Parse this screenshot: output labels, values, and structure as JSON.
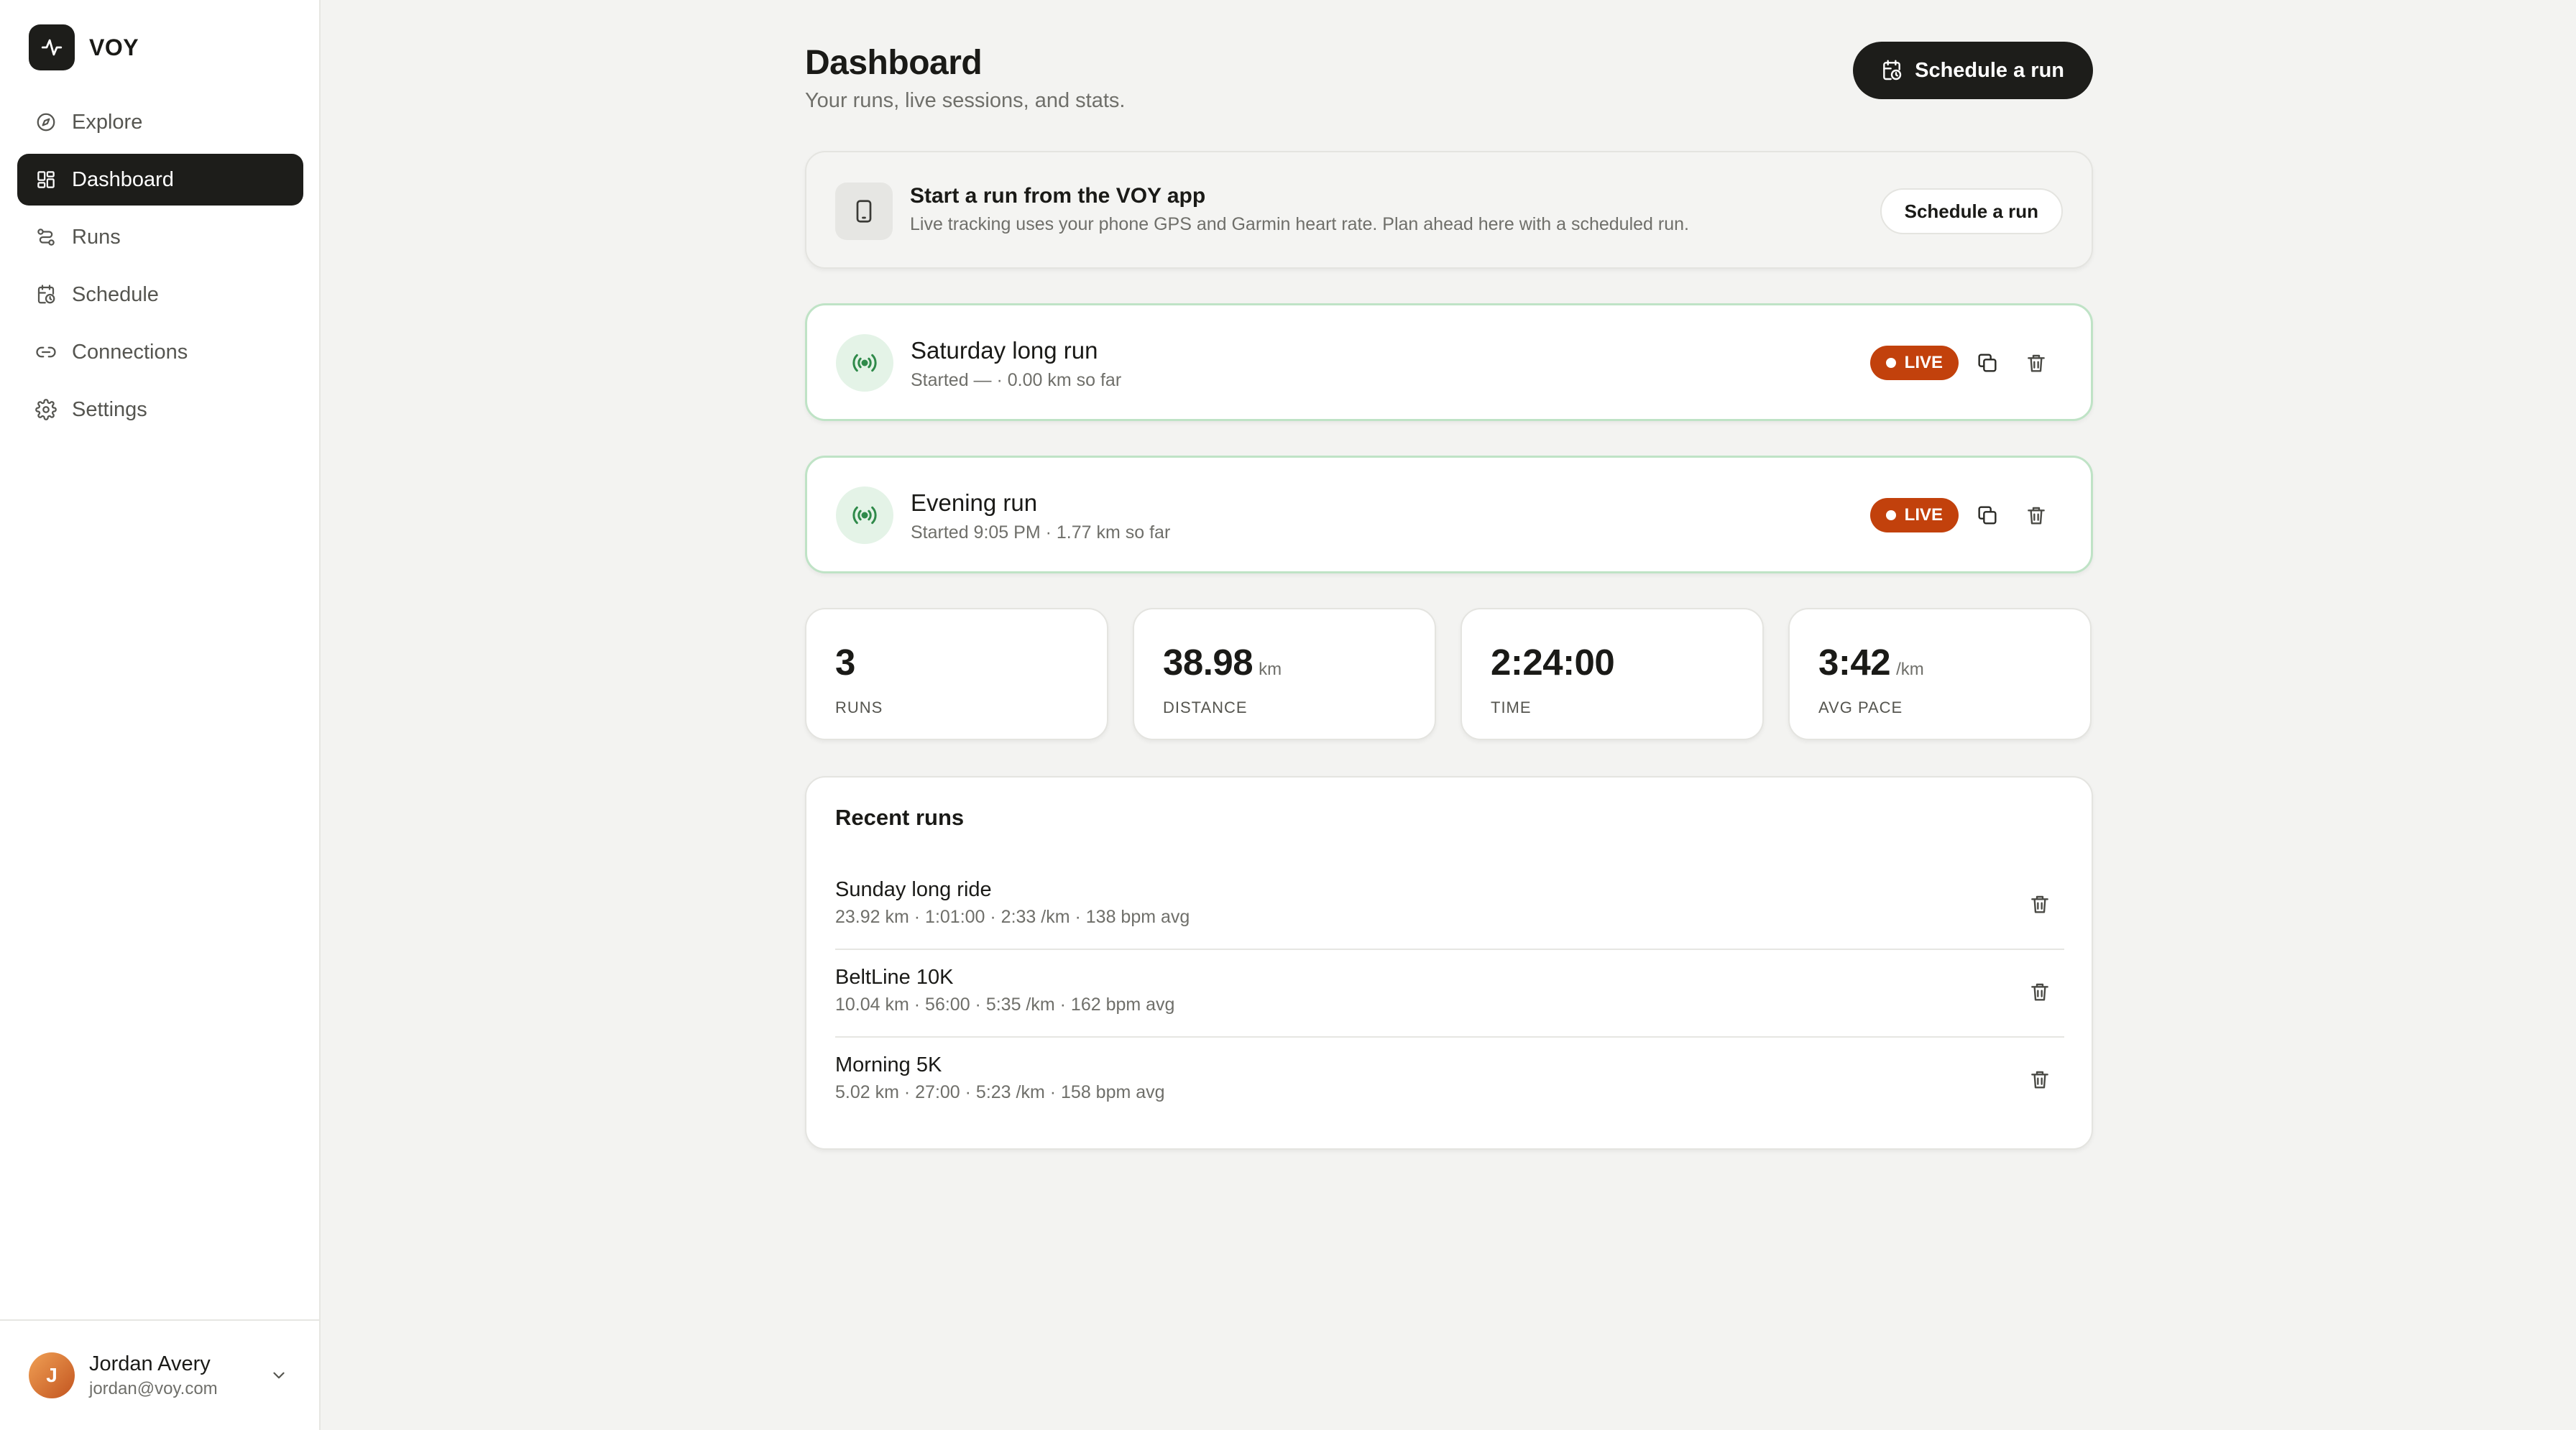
{
  "app": {
    "name": "VOY",
    "logo_icon": "activity-pulse-icon"
  },
  "sidebar": {
    "items": [
      {
        "label": "Explore",
        "icon": "compass-icon",
        "active": false
      },
      {
        "label": "Dashboard",
        "icon": "grid-icon",
        "active": true
      },
      {
        "label": "Runs",
        "icon": "route-icon",
        "active": false
      },
      {
        "label": "Schedule",
        "icon": "calendar-clock-icon",
        "active": false
      },
      {
        "label": "Connections",
        "icon": "link-icon",
        "active": false
      },
      {
        "label": "Settings",
        "icon": "gear-icon",
        "active": false
      }
    ]
  },
  "user": {
    "initial": "J",
    "name": "Jordan Avery",
    "email": "jordan@voy.com"
  },
  "header": {
    "title": "Dashboard",
    "subtitle": "Your runs, live sessions, and stats.",
    "schedule_label": "Schedule a run"
  },
  "app_banner": {
    "title": "Start a run from the VOY app",
    "description": "Live tracking uses your phone GPS and Garmin heart rate. Plan ahead here with a scheduled run.",
    "button_label": "Schedule a run"
  },
  "live_sessions": [
    {
      "title": "Saturday long run",
      "meta": "Started — · 0.00 km so far",
      "badge": "LIVE"
    },
    {
      "title": "Evening run",
      "meta": "Started 9:05 PM · 1.77 km so far",
      "badge": "LIVE"
    }
  ],
  "stats": [
    {
      "value": "3",
      "unit": "",
      "label": "RUNS"
    },
    {
      "value": "38.98",
      "unit": "km",
      "label": "DISTANCE"
    },
    {
      "value": "2:24:00",
      "unit": "",
      "label": "TIME"
    },
    {
      "value": "3:42",
      "unit": "/km",
      "label": "AVG PACE"
    }
  ],
  "recent": {
    "title": "Recent runs",
    "runs": [
      {
        "name": "Sunday long ride",
        "meta": "23.92 km · 1:01:00 · 2:33 /km · 138 bpm avg"
      },
      {
        "name": "BeltLine 10K",
        "meta": "10.04 km · 56:00 · 5:35 /km · 162 bpm avg"
      },
      {
        "name": "Morning 5K",
        "meta": "5.02 km · 27:00 · 5:23 /km · 158 bpm avg"
      }
    ]
  },
  "colors": {
    "accent_dark": "#1d1d1a",
    "live_badge": "#c2410c",
    "live_border": "#bfe3c6",
    "live_icon_bg": "#e4f3e7",
    "live_icon": "#2f8a4a"
  }
}
